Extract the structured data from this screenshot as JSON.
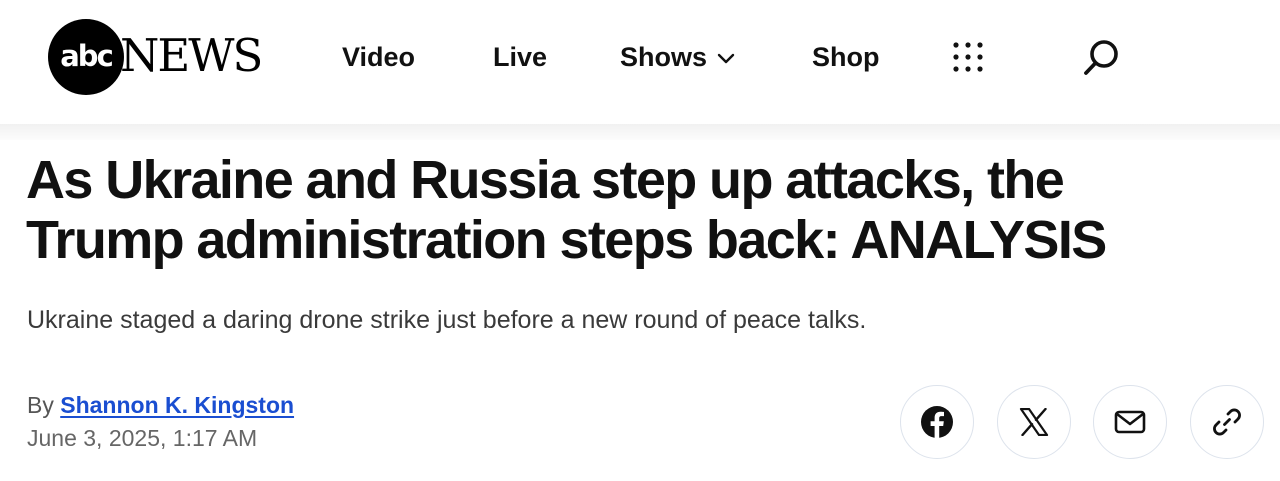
{
  "brand": {
    "logo_abc": "abc",
    "logo_news": "NEWS"
  },
  "nav": {
    "video": "Video",
    "live": "Live",
    "shows": "Shows",
    "shop": "Shop"
  },
  "icons": {
    "shows_dropdown": "chevron-down-icon",
    "menu": "grid-dots-icon",
    "search": "search-icon",
    "facebook": "facebook-icon",
    "x": "x-icon",
    "email": "email-icon",
    "link": "link-icon"
  },
  "article": {
    "headline_line1": "As Ukraine and Russia step up attacks, the",
    "headline_line2": "Trump administration steps back: ANALYSIS",
    "subheadline": "Ukraine staged a daring drone strike just before a new round of peace talks.",
    "byline_prefix": "By",
    "author": "Shannon K. Kingston",
    "timestamp": "June 3, 2025, 1:17 AM"
  },
  "colors": {
    "link_blue": "#1a4ed1",
    "text": "#111111",
    "share_border": "#dde3ec"
  }
}
